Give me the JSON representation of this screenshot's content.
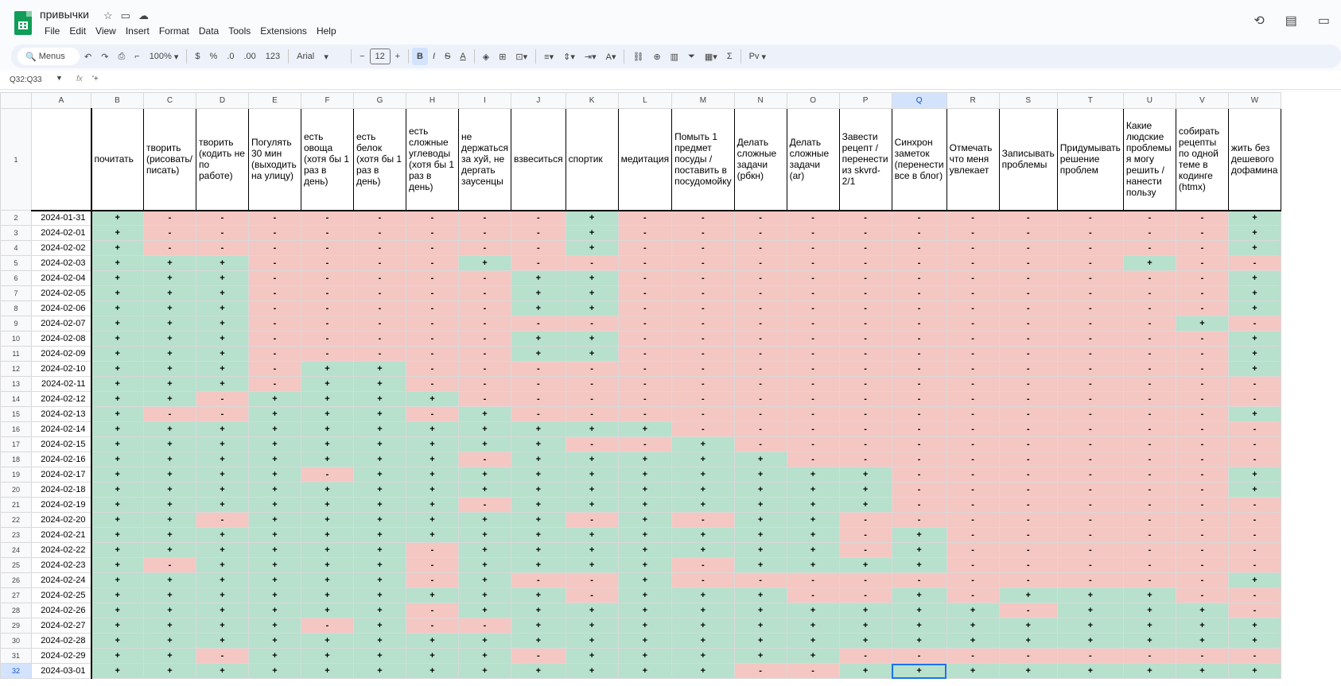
{
  "doc": {
    "title": "привычки",
    "menu": [
      "File",
      "Edit",
      "View",
      "Insert",
      "Format",
      "Data",
      "Tools",
      "Extensions",
      "Help"
    ]
  },
  "toolbar": {
    "menus_label": "Menus",
    "zoom": "100%",
    "currency": "$",
    "percent": "%",
    "dec_less": ".0",
    "dec_more": ".00",
    "number_format": "123",
    "font": "Arial",
    "font_size": "12",
    "bold": "B",
    "italic": "I",
    "strike": "S",
    "text_color": "A",
    "sigma": "Σ",
    "language": "Pv"
  },
  "formula_bar": {
    "name_box": "Q32:Q33",
    "fx": "fx",
    "value": "'+"
  },
  "columns": [
    "A",
    "B",
    "C",
    "D",
    "E",
    "F",
    "G",
    "H",
    "I",
    "J",
    "K",
    "L",
    "M",
    "N",
    "O",
    "P",
    "Q",
    "R",
    "S",
    "T",
    "U",
    "V",
    "W"
  ],
  "selected_column": "Q",
  "selected_row": "32",
  "header_row_number": "1",
  "headers": [
    "почитать",
    "творить (рисовать/писать)",
    "творить (кодить не по работе)",
    "Погулять 30 мин (выходить на улицу)",
    "есть овоща (хотя бы 1 раз в день)",
    "есть белок (хотя бы 1 раз в день)",
    "есть сложные углеводы (хотя бы 1 раз в день)",
    "не держаться за хуй, не дергать заусенцы",
    "взвеситься",
    "спортик",
    "медитация",
    "Помыть 1 предмет посуды / поставить в посудомойку",
    "Делать сложные задачи (рбкн)",
    "Делать сложные задачи (ar)",
    "Завести рецепт / перенести из skvrd-2/1",
    "Синхрон заметок (перенести все в блог)",
    "Отмечать что меня увлекает",
    "Записывать проблемы",
    "Придумывать решение проблем",
    "Какие людские проблемы я могу решить / нанести пользу",
    "собирать рецепты по одной теме в кодинге (htmx)",
    "жить без дешевого дофамина"
  ],
  "rows": [
    {
      "n": "2",
      "date": "2024-01-31",
      "v": "+--------+-----------+"
    },
    {
      "n": "3",
      "date": "2024-02-01",
      "v": "+--------+-----------+"
    },
    {
      "n": "4",
      "date": "2024-02-02",
      "v": "+--------+-----------+"
    },
    {
      "n": "5",
      "date": "2024-02-03",
      "v": "+++----+-----------+"
    },
    {
      "n": "6",
      "date": "2024-02-04",
      "v": "+++-----++-----------+"
    },
    {
      "n": "7",
      "date": "2024-02-05",
      "v": "+++-----++-----------+"
    },
    {
      "n": "8",
      "date": "2024-02-06",
      "v": "+++-----++-----------+"
    },
    {
      "n": "9",
      "date": "2024-02-07",
      "v": "+++-----------------+"
    },
    {
      "n": "10",
      "date": "2024-02-08",
      "v": "+++-----++-----------+"
    },
    {
      "n": "11",
      "date": "2024-02-09",
      "v": "+++-----++-----------+"
    },
    {
      "n": "12",
      "date": "2024-02-10",
      "v": "+++-++---------------+"
    },
    {
      "n": "13",
      "date": "2024-02-11",
      "v": "+++-++----------------"
    },
    {
      "n": "14",
      "date": "2024-02-12",
      "v": "++-++++---------------"
    },
    {
      "n": "15",
      "date": "2024-02-13",
      "v": "+--+++-+-------------+"
    },
    {
      "n": "16",
      "date": "2024-02-14",
      "v": "+++++++++++-----------"
    },
    {
      "n": "17",
      "date": "2024-02-15",
      "v": "+++++++++--+----------"
    },
    {
      "n": "18",
      "date": "2024-02-16",
      "v": "+++++++-+++++---------"
    },
    {
      "n": "19",
      "date": "2024-02-17",
      "v": "++++-++++++++++------+"
    },
    {
      "n": "20",
      "date": "2024-02-18",
      "v": "+++++++++++++++------+"
    },
    {
      "n": "21",
      "date": "2024-02-19",
      "v": "+++++++-+++++++-------"
    },
    {
      "n": "22",
      "date": "2024-02-20",
      "v": "++-++++++-+-++--------"
    },
    {
      "n": "23",
      "date": "2024-02-21",
      "v": "++++++++++++++-+------"
    },
    {
      "n": "24",
      "date": "2024-02-22",
      "v": "++++++-+++++++-+------"
    },
    {
      "n": "25",
      "date": "2024-02-23",
      "v": "+-++++-++++-++++------"
    },
    {
      "n": "26",
      "date": "2024-02-24",
      "v": "++++++-+--+----------+"
    },
    {
      "n": "27",
      "date": "2024-02-25",
      "v": "+++++++++-+++--+-+++--"
    },
    {
      "n": "28",
      "date": "2024-02-26",
      "v": "++++++-++++++++++-+++-"
    },
    {
      "n": "29",
      "date": "2024-02-27",
      "v": "++++-+--++++++++++++++"
    },
    {
      "n": "30",
      "date": "2024-02-28",
      "v": "++++++++++++++++++++++"
    },
    {
      "n": "31",
      "date": "2024-02-29",
      "v": "++-+++++-+++++--------"
    },
    {
      "n": "32",
      "date": "2024-03-01",
      "v": "++++++++++++--++++++++"
    }
  ],
  "selected_cell": {
    "row": "32",
    "col": "Q"
  }
}
